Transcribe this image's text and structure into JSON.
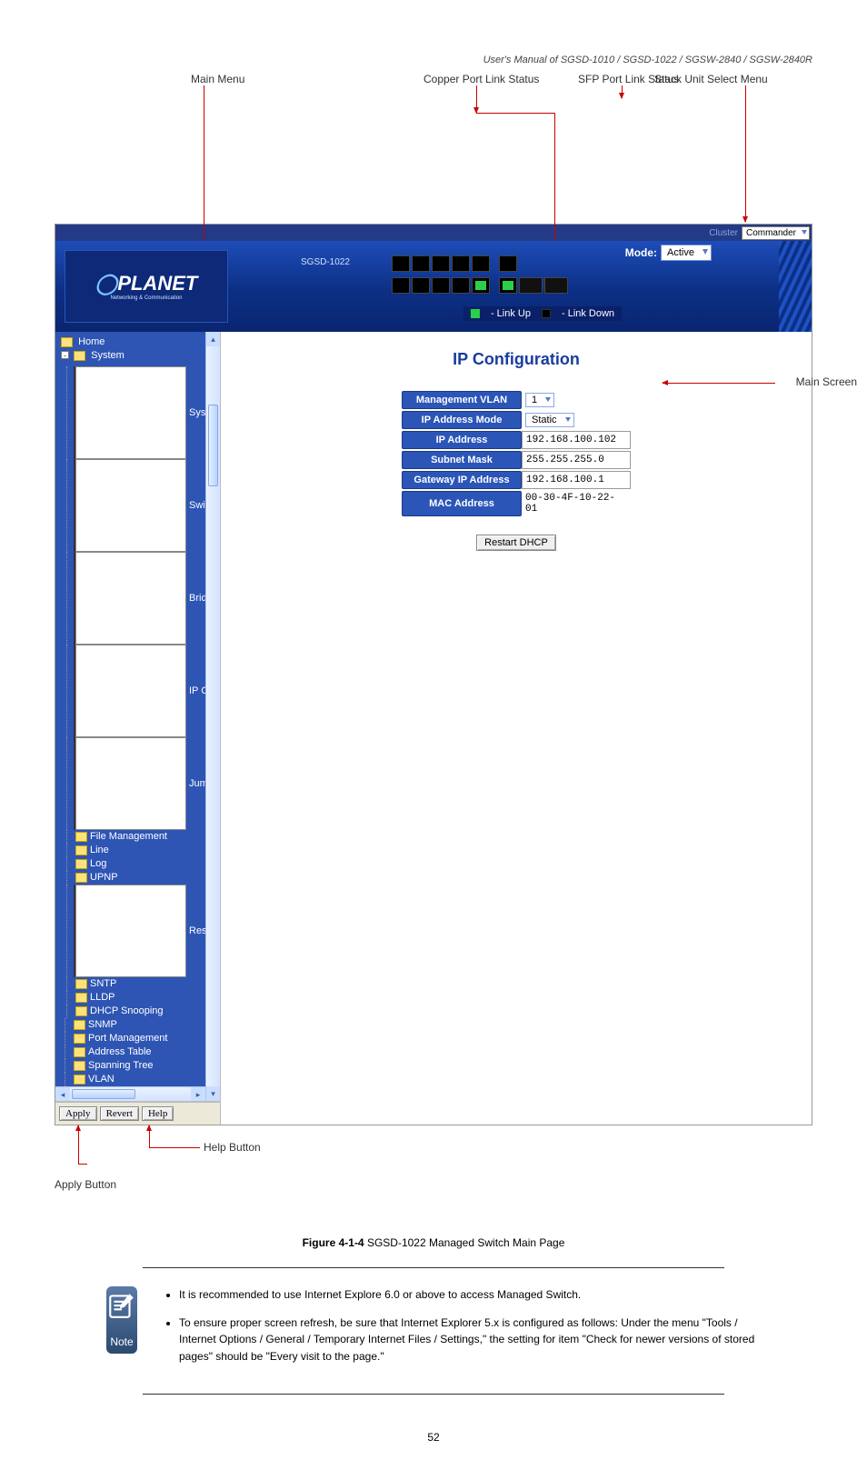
{
  "doc": {
    "title": "User's Manual of SGSD-1010 / SGSD-1022 / SGSW-2840 / SGSW-2840R",
    "model_number": "SGSD-1022 Managed Switch"
  },
  "callouts": {
    "main_menu": "Main Menu",
    "copper_port": "Copper Port Link Status",
    "sfp_port": "SFP Port Link Status",
    "stack_select": "Stack Unit Select Menu",
    "main_screen": "Main Screen",
    "help_button": "Help Button",
    "apply_button": "Apply Button"
  },
  "cluster": {
    "prefix_label": "Cluster",
    "selected": "Commander"
  },
  "device": {
    "logo": "PLANET",
    "logo_sub": "Networking & Communication",
    "model": "SGSD-1022",
    "legend_up": "- Link Up",
    "legend_down": "- Link Down",
    "mode_label": "Mode:",
    "mode_value": "Active"
  },
  "tree": {
    "home": "Home",
    "system": "System",
    "items": [
      "System Information",
      "Switch Information",
      "Bridge Extension Confi",
      "IP Configuration",
      "Jumbo Frames",
      "File Management",
      "Line",
      "Log",
      "UPNP",
      "Reset",
      "SNTP",
      "LLDP",
      "DHCP Snooping"
    ],
    "after_system": [
      "SNMP",
      "Port Management",
      "Address Table",
      "Spanning Tree",
      "VLAN"
    ]
  },
  "buttons": {
    "apply": "Apply",
    "revert": "Revert",
    "help": "Help"
  },
  "config": {
    "title": "IP Configuration",
    "rows": {
      "mgmt_vlan": {
        "label": "Management VLAN",
        "value": "1"
      },
      "ip_mode": {
        "label": "IP Address Mode",
        "value": "Static"
      },
      "ip": {
        "label": "IP Address",
        "value": "192.168.100.102"
      },
      "mask": {
        "label": "Subnet Mask",
        "value": "255.255.255.0"
      },
      "gw": {
        "label": "Gateway IP Address",
        "value": "192.168.100.1"
      },
      "mac": {
        "label": "MAC Address",
        "value": "00-30-4F-10-22-01"
      }
    },
    "restart": "Restart DHCP"
  },
  "figure_caption_prefix": "Figure 4-1-4",
  "figure_caption_suffix": " Main Page",
  "notes": {
    "heading": "Note",
    "items": [
      "It is recommended to use Internet Explore 6.0 or above to access Managed Switch.",
      "To ensure proper screen refresh, be sure that Internet Explorer 5.x is configured as follows: Under the menu \"Tools / Internet Options / General / Temporary Internet Files / Settings,\" the setting for item \"Check for newer versions of stored pages\" should be \"Every visit to the page.\""
    ]
  },
  "page_number": "52"
}
